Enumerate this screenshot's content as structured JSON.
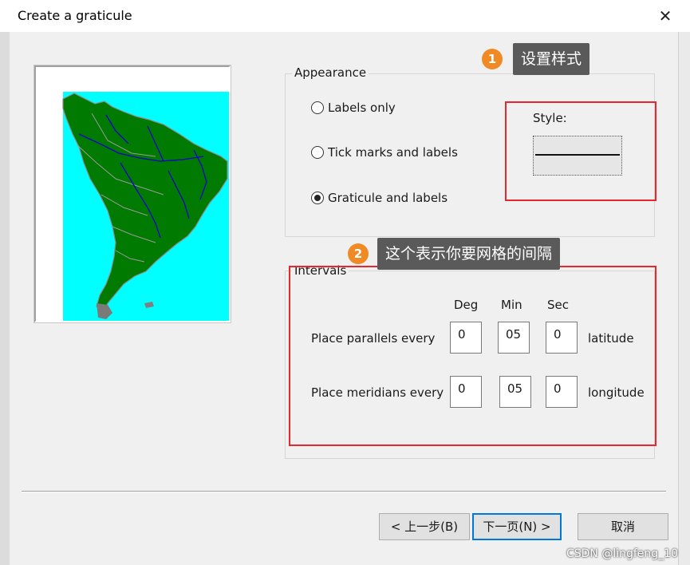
{
  "window": {
    "title": "Create a graticule",
    "close_glyph": "✕"
  },
  "appearance": {
    "legend": "Appearance",
    "options": [
      {
        "label": "Labels only",
        "checked": false
      },
      {
        "label": "Tick marks and labels",
        "checked": false
      },
      {
        "label": "Graticule and labels",
        "checked": true
      }
    ],
    "style_label": "Style:"
  },
  "intervals": {
    "legend": "Intervals",
    "headers": [
      "Deg",
      "Min",
      "Sec"
    ],
    "rows": [
      {
        "label": "Place parallels every",
        "deg": "0",
        "min": "05",
        "sec": "0",
        "unit": "latitude"
      },
      {
        "label": "Place meridians every",
        "deg": "0",
        "min": "05",
        "sec": "0",
        "unit": "longitude"
      }
    ]
  },
  "annotations": [
    {
      "number": "1",
      "text": "设置样式"
    },
    {
      "number": "2",
      "text": "这个表示你要网格的间隔"
    }
  ],
  "buttons": {
    "back": "< 上一步(B)",
    "next": "下一页(N) >",
    "cancel": "取消"
  },
  "watermark": "CSDN @lingfeng_10",
  "colors": {
    "ocean": "#00ffff",
    "land": "#007a00",
    "rivers": "#0000cc",
    "borders": "#9a9a9a",
    "highlight": "#e8262e",
    "badge": "#f08a24",
    "callout_bg": "#5a5a5a"
  }
}
